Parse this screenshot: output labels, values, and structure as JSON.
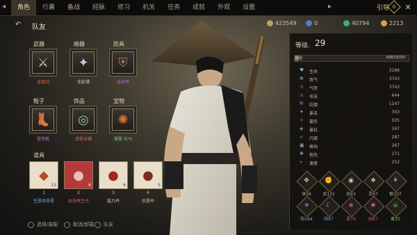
{
  "tabs": [
    "角色",
    "行囊",
    "备战",
    "经脉",
    "修习",
    "机关",
    "任务",
    "成就",
    "外观",
    "设置"
  ],
  "guide_label": "引导",
  "guide_badge": "0",
  "header": {
    "title": "队友"
  },
  "resources": [
    {
      "value": "423549",
      "color": "#b9a062"
    },
    {
      "value": "0",
      "color": "#4f7bd6"
    },
    {
      "value": "40794",
      "color": "#3eaa8a"
    },
    {
      "value": "2213",
      "color": "#d6a24f"
    }
  ],
  "sections": {
    "weapon": "武器",
    "hidden": "暗器",
    "armor": "防具",
    "shoes": "鞋子",
    "accessory": "饰品",
    "treasure": "宝物",
    "items": "道具"
  },
  "equipment": {
    "weapon": {
      "name": "龙泉剑",
      "color": "#d36b4b"
    },
    "hidden": {
      "name": "玄影镖",
      "color": "#cfc6b4"
    },
    "armor": {
      "name": "金丝甲",
      "color": "#b26bd4"
    },
    "shoes": {
      "name": "登萍靴",
      "color": "#b26bd4"
    },
    "accessory": {
      "name": "清翠玉镯",
      "color": "#d36b4b"
    },
    "treasure": {
      "name": "饕餮·炎马",
      "color": "#6dc46a"
    }
  },
  "consumables": [
    {
      "index": "1",
      "name": "生肌续骨膏",
      "count": "13",
      "color": "#6ea6dc"
    },
    {
      "index": "2",
      "name": "血海再生丹",
      "count": "6",
      "color": "#c95a7a"
    },
    {
      "index": "3",
      "name": "猛力丹",
      "count": "6",
      "color": "#cfc6b4"
    },
    {
      "index": "4",
      "name": "抗骨丹",
      "count": "5",
      "color": "#cfc6b4"
    }
  ],
  "hints": [
    "选择/装配",
    "取消/卸载",
    "队友"
  ],
  "stats_panel": {
    "level_label": "等级.",
    "level": "29",
    "xp_label": "经验",
    "xp_text": "698/18300",
    "xp_fraction": 0.038,
    "stats": [
      {
        "name": "生命",
        "value": "3186"
      },
      {
        "name": "真气",
        "value": "3743"
      },
      {
        "name": "气势",
        "value": "3743"
      },
      {
        "name": "攻击",
        "value": "644"
      },
      {
        "name": "防御",
        "value": "1147"
      },
      {
        "name": "暴击",
        "value": "303"
      },
      {
        "name": "暴伤",
        "value": "505"
      },
      {
        "name": "暴抗",
        "value": "167"
      },
      {
        "name": "闪避",
        "value": "287"
      },
      {
        "name": "格挡",
        "value": "267"
      },
      {
        "name": "拖伤",
        "value": "271"
      },
      {
        "name": "速度",
        "value": "253"
      }
    ],
    "skills_row1": [
      {
        "label": "体56",
        "color": "#cfc6b4"
      },
      {
        "label": "武131",
        "color": "#cfc6b4"
      },
      {
        "label": "念63",
        "color": "#cfc6b4"
      },
      {
        "label": "灵67",
        "color": "#cfc6b4"
      },
      {
        "label": "敏107",
        "color": "#cfc6b4"
      }
    ],
    "skills_row2": [
      {
        "label": "阳184",
        "color": "#7aa7e6"
      },
      {
        "label": "阴67",
        "color": "#7aa7e6"
      },
      {
        "label": "柔78",
        "color": "#c95a7a"
      },
      {
        "label": "刚67",
        "color": "#c95a7a"
      },
      {
        "label": "毒35",
        "color": "#6dc46a"
      }
    ]
  }
}
